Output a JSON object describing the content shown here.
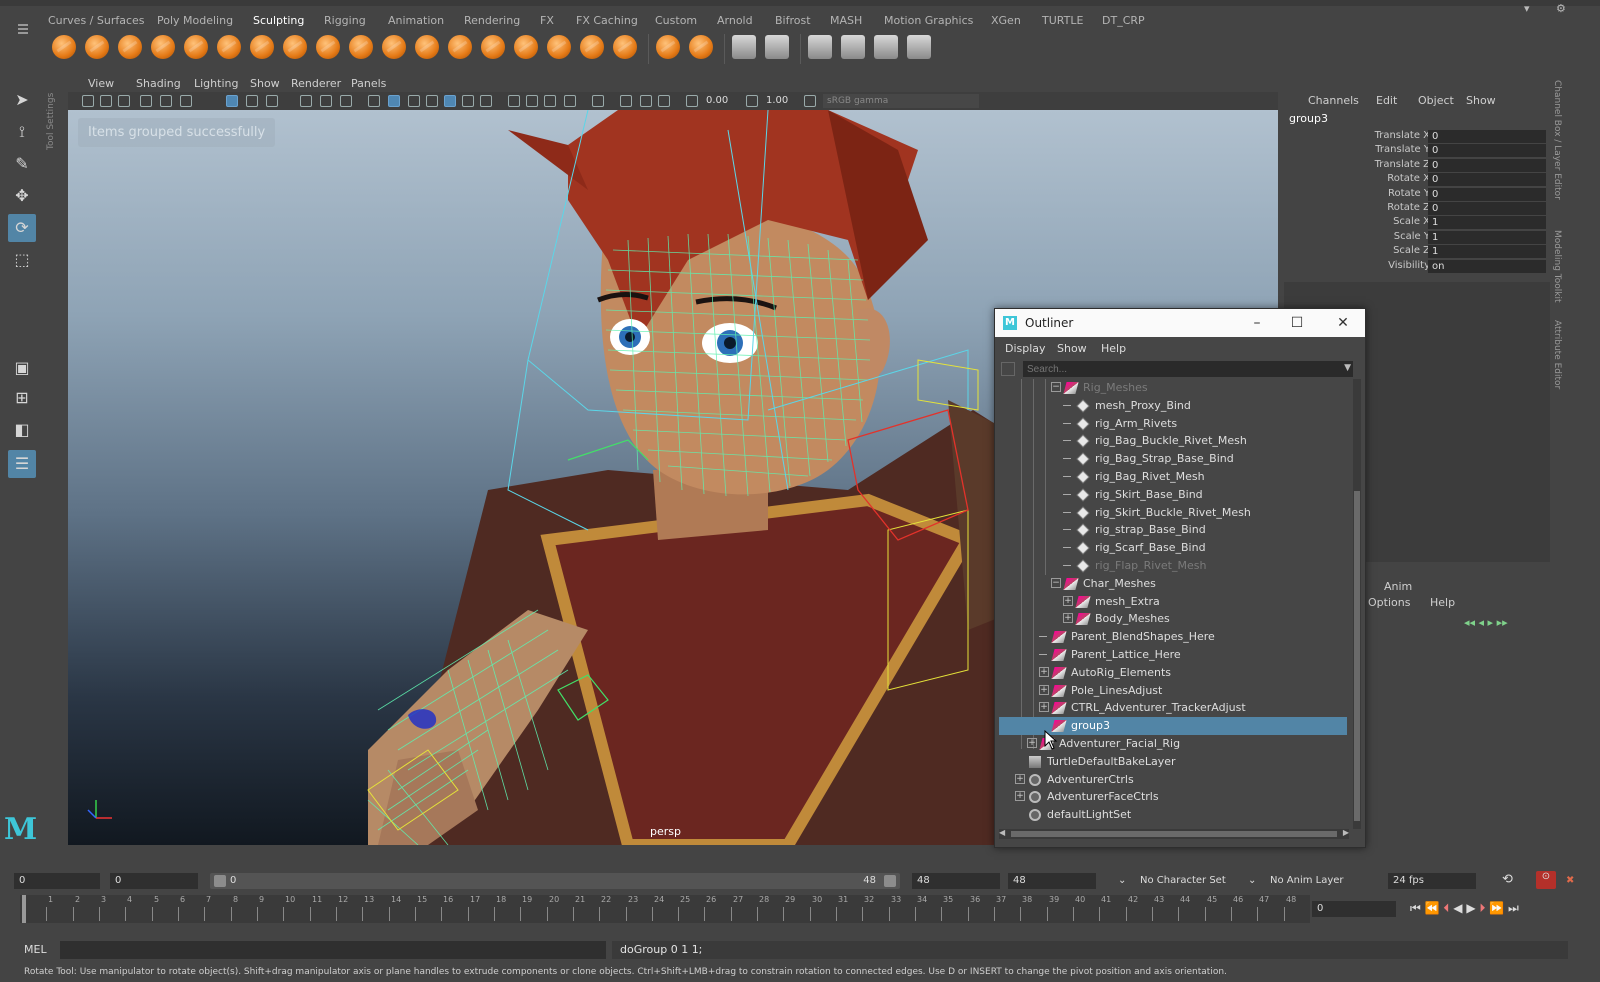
{
  "shelf_tabs": [
    "Curves / Surfaces",
    "Poly Modeling",
    "Sculpting",
    "Rigging",
    "Animation",
    "Rendering",
    "FX",
    "FX Caching",
    "Custom",
    "Arnold",
    "Bifrost",
    "MASH",
    "Motion Graphics",
    "XGen",
    "TURTLE",
    "DT_CRP"
  ],
  "active_shelf_tab": "Sculpting",
  "shelf_icon_names": [
    "sculpt-brush-icon",
    "smooth-brush-icon",
    "relax-brush-icon",
    "grab-brush-icon",
    "pinch-brush-icon",
    "flatten-brush-icon",
    "foamy-brush-icon",
    "spray-brush-icon",
    "repeat-brush-icon",
    "imprint-brush-icon",
    "wax-brush-icon",
    "scrape-brush-icon",
    "fill-brush-icon",
    "knife-brush-icon",
    "smear-brush-icon",
    "bulge-brush-icon",
    "amplify-brush-icon",
    "freeze-brush-icon",
    "mask-brush-icon",
    "transfer-attributes-icon",
    "display-sculpt-icon",
    "convert-to-frozen-icon",
    "sculpt-layer-icon",
    "sculpt-mesh-icon",
    "blend-shape-icon",
    "tension-icon"
  ],
  "panel_menu": [
    "View",
    "Shading",
    "Lighting",
    "Show",
    "Renderer",
    "Panels"
  ],
  "viewport_toolbar": {
    "near_value": "0.00",
    "far_value": "1.00",
    "color_space": "sRGB gamma"
  },
  "viewport": {
    "hud_message": "Items grouped successfully",
    "camera": "persp"
  },
  "channel_box": {
    "menu": [
      "Channels",
      "Edit",
      "Object",
      "Show"
    ],
    "object_name": "group3",
    "attributes": [
      {
        "label": "Translate X",
        "value": "0"
      },
      {
        "label": "Translate Y",
        "value": "0"
      },
      {
        "label": "Translate Z",
        "value": "0"
      },
      {
        "label": "Rotate X",
        "value": "0"
      },
      {
        "label": "Rotate Y",
        "value": "0"
      },
      {
        "label": "Rotate Z",
        "value": "0"
      },
      {
        "label": "Scale X",
        "value": "1"
      },
      {
        "label": "Scale Y",
        "value": "1"
      },
      {
        "label": "Scale Z",
        "value": "1"
      },
      {
        "label": "Visibility",
        "value": "on"
      }
    ]
  },
  "right_side_tabs": [
    "Channel Box / Layer Editor",
    "Modeling Toolkit",
    "Attribute Editor"
  ],
  "layer_editor": {
    "tab": "Anim",
    "menu": [
      "Options",
      "Help"
    ]
  },
  "outliner": {
    "title": "Outliner",
    "menu": [
      "Display",
      "Show",
      "Help"
    ],
    "search_placeholder": "Search...",
    "items": [
      {
        "name": "Rig_Meshes",
        "icon": "group",
        "dim": true
      },
      {
        "name": "mesh_Proxy_Bind",
        "icon": "mesh"
      },
      {
        "name": "rig_Arm_Rivets",
        "icon": "mesh"
      },
      {
        "name": "rig_Bag_Buckle_Rivet_Mesh",
        "icon": "mesh"
      },
      {
        "name": "rig_Bag_Strap_Base_Bind",
        "icon": "mesh"
      },
      {
        "name": "rig_Bag_Rivet_Mesh",
        "icon": "mesh"
      },
      {
        "name": "rig_Skirt_Base_Bind",
        "icon": "mesh"
      },
      {
        "name": "rig_Skirt_Buckle_Rivet_Mesh",
        "icon": "mesh"
      },
      {
        "name": "rig_strap_Base_Bind",
        "icon": "mesh"
      },
      {
        "name": "rig_Scarf_Base_Bind",
        "icon": "mesh"
      },
      {
        "name": "rig_Flap_Rivet_Mesh",
        "icon": "mesh",
        "dim": true
      },
      {
        "name": "Char_Meshes",
        "icon": "group"
      },
      {
        "name": "mesh_Extra",
        "icon": "group"
      },
      {
        "name": "Body_Meshes",
        "icon": "group"
      },
      {
        "name": "Parent_BlendShapes_Here",
        "icon": "group"
      },
      {
        "name": "Parent_Lattice_Here",
        "icon": "group"
      },
      {
        "name": "AutoRig_Elements",
        "icon": "group"
      },
      {
        "name": "Pole_LinesAdjust",
        "icon": "group"
      },
      {
        "name": "CTRL_Adventurer_TrackerAdjust",
        "icon": "group"
      },
      {
        "name": "group3",
        "icon": "group",
        "selected": true
      },
      {
        "name": "Adventurer_Facial_Rig",
        "icon": "group"
      },
      {
        "name": "TurtleDefaultBakeLayer",
        "icon": "layer"
      },
      {
        "name": "AdventurerCtrls",
        "icon": "set"
      },
      {
        "name": "AdventurerFaceCtrls",
        "icon": "set"
      },
      {
        "name": "defaultLightSet",
        "icon": "set"
      }
    ]
  },
  "range_slider": {
    "start_frame": "0",
    "playback_start": "0",
    "range_start": "0",
    "range_end": "48",
    "playback_end": "48",
    "end_frame": "48",
    "character_set": "No Character Set",
    "anim_layer": "No Anim Layer",
    "fps": "24 fps"
  },
  "timeline": {
    "ticks": [
      "1",
      "2",
      "3",
      "4",
      "5",
      "6",
      "7",
      "8",
      "9",
      "10",
      "11",
      "12",
      "13",
      "14",
      "15",
      "16",
      "17",
      "18",
      "19",
      "20",
      "21",
      "22",
      "23",
      "24",
      "25",
      "26",
      "27",
      "28",
      "29",
      "30",
      "31",
      "32",
      "33",
      "34",
      "35",
      "36",
      "37",
      "38",
      "39",
      "40",
      "41",
      "42",
      "43",
      "44",
      "45",
      "46",
      "47",
      "48"
    ],
    "current_frame": "0"
  },
  "command_line": {
    "language": "MEL",
    "result": "doGroup 0 1 1;"
  },
  "help_line": "Rotate Tool: Use manipulator to rotate object(s). Shift+drag manipulator axis or plane handles to extrude components or clone objects. Ctrl+Shift+LMB+drag to constrain rotation to connected edges. Use D or INSERT to change the pivot position and axis orientation."
}
